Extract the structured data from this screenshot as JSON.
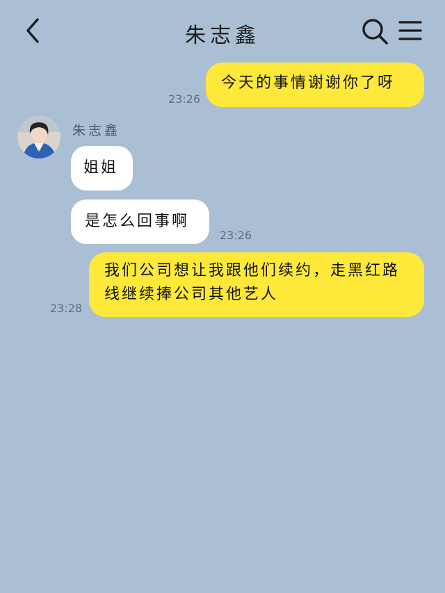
{
  "header": {
    "title": "朱志鑫"
  },
  "messages": [
    {
      "direction": "out",
      "text": "今天的事情谢谢你了呀",
      "time": "23:26"
    },
    {
      "direction": "in",
      "text": "姐姐",
      "time": ""
    },
    {
      "direction": "in",
      "text": "是怎么回事啊",
      "time": "23:26"
    },
    {
      "direction": "out",
      "text": "我们公司想让我跟他们续约，走黑红路线继续捧公司其他艺人",
      "time": "23:28"
    }
  ],
  "contact": {
    "name": "朱志鑫"
  },
  "colors": {
    "background": "#aabfd3",
    "outgoing_bubble": "#fee93a",
    "incoming_bubble": "#ffffff"
  },
  "icons": [
    "back-arrow-icon",
    "search-icon",
    "menu-icon"
  ]
}
